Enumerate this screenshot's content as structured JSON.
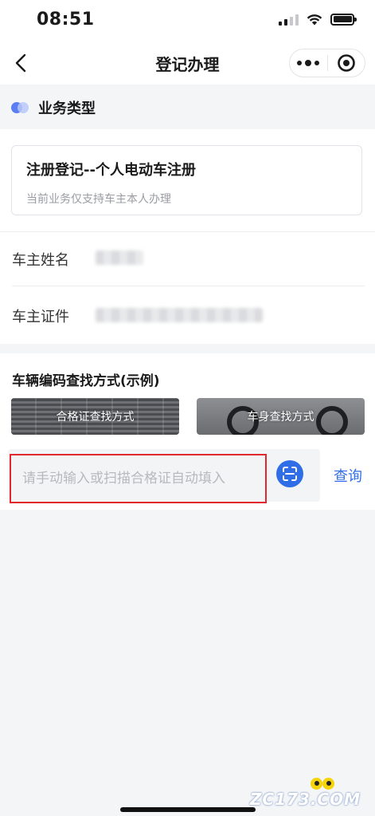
{
  "status_bar": {
    "time": "08:51",
    "icons": [
      "cellular-signal-icon",
      "wifi-icon",
      "battery-icon"
    ]
  },
  "nav": {
    "title": "登记办理",
    "back_icon": "chevron-left-icon",
    "more_icon": "more-dots-icon",
    "close_icon": "target-circle-icon"
  },
  "business_type": {
    "heading": "业务类型",
    "selected": {
      "title": "注册登记--个人电动车注册",
      "note": "当前业务仅支持车主本人办理"
    }
  },
  "owner": {
    "name_label": "车主姓名",
    "id_label": "车主证件"
  },
  "vehicle_code": {
    "heading": "车辆编码查找方式(示例)",
    "examples": [
      {
        "label": "合格证查找方式"
      },
      {
        "label": "车身查找方式"
      }
    ],
    "input_placeholder": "请手动输入或扫描合格证自动填入",
    "scan_icon": "scan-icon",
    "query_label": "查询"
  },
  "watermark": {
    "text": "ZC173.COM"
  },
  "colors": {
    "accent": "#2f6ee6",
    "highlight_border": "#e0282e",
    "toggle_primary": "#5b7ff3"
  }
}
